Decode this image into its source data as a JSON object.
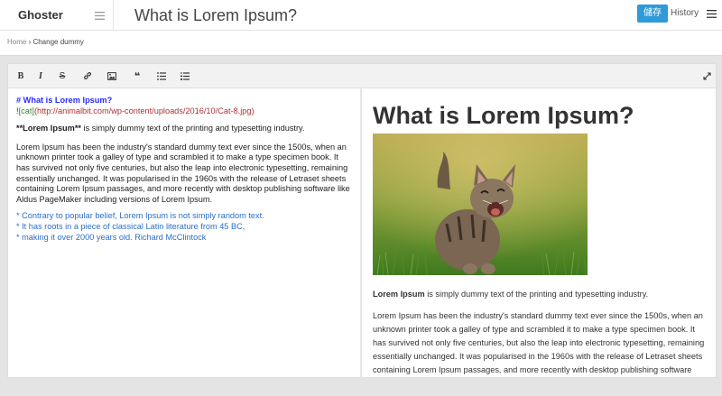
{
  "app": {
    "name": "Ghoster"
  },
  "header": {
    "doc_title": "What is Lorem Ipsum?",
    "save_label": "儲存",
    "history_label": "History"
  },
  "breadcrumb": {
    "home": "Home",
    "sep": " › ",
    "current": "Change dummy"
  },
  "toolbar": {
    "buttons": [
      {
        "name": "bold",
        "label": "B"
      },
      {
        "name": "italic",
        "label": "I"
      },
      {
        "name": "strikethrough",
        "label": "S"
      },
      {
        "name": "link",
        "label": ""
      },
      {
        "name": "image",
        "label": ""
      },
      {
        "name": "quote",
        "label": "❝"
      },
      {
        "name": "bullet-list",
        "label": ""
      },
      {
        "name": "numbered-list",
        "label": ""
      }
    ]
  },
  "editor": {
    "heading": "# What is Lorem Ipsum?",
    "img_bang": "!",
    "img_alt": "[cat]",
    "img_url": "(http://animalbit.com/wp-content/uploads/2016/10/Cat-8.jpg)",
    "para1_bold": "**Lorem Ipsum**",
    "para1_rest": " is simply dummy text of the printing and typesetting industry.",
    "para2": "Lorem Ipsum has been the industry's standard dummy text ever since the 1500s, when an unknown printer took a galley of type and scrambled it to make a type specimen book. It has survived not only five centuries, but also the leap into electronic typesetting, remaining essentially unchanged. It was popularised in the 1960s with the release of Letraset sheets containing Lorem Ipsum passages, and more recently with desktop publishing software like Aldus PageMaker including versions of Lorem Ipsum.",
    "list": [
      "* Contrary to popular belief, Lorem Ipsum is not simply random text.",
      "* It has roots in a piece of classical Latin literature from 45 BC,",
      "* making it over 2000 years old. Richard McClintock"
    ]
  },
  "preview": {
    "heading": "What is Lorem Ipsum?",
    "image_alt": "cat",
    "para1_bold": "Lorem Ipsum",
    "para1_rest": " is simply dummy text of the printing and typesetting industry.",
    "para2": "Lorem Ipsum has been the industry's standard dummy text ever since the 1500s, when an unknown printer took a galley of type and scrambled it to make a type specimen book. It has survived not only five centuries, but also the leap into electronic typesetting, remaining essentially unchanged. It was popularised in the 1960s with the release of Letraset sheets containing Lorem Ipsum passages, and more recently with desktop publishing software like Aldus PageMaker including versions of Lorem Ipsum."
  }
}
